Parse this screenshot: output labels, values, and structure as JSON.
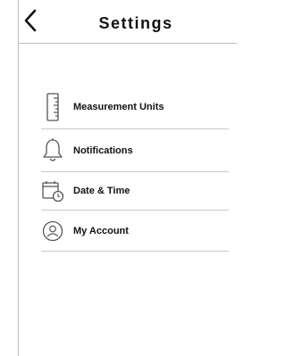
{
  "header": {
    "title": "Settings",
    "back_icon": "chevron-left-icon"
  },
  "menu": {
    "items": [
      {
        "label": "Measurement Units",
        "icon": "ruler-icon"
      },
      {
        "label": "Notifications",
        "icon": "bell-icon"
      },
      {
        "label": "Date & Time",
        "icon": "calendar-clock-icon"
      },
      {
        "label": "My Account",
        "icon": "account-icon"
      }
    ]
  },
  "colors": {
    "divider": "#c8c8c8",
    "text": "#111111",
    "icon": "#555555"
  }
}
